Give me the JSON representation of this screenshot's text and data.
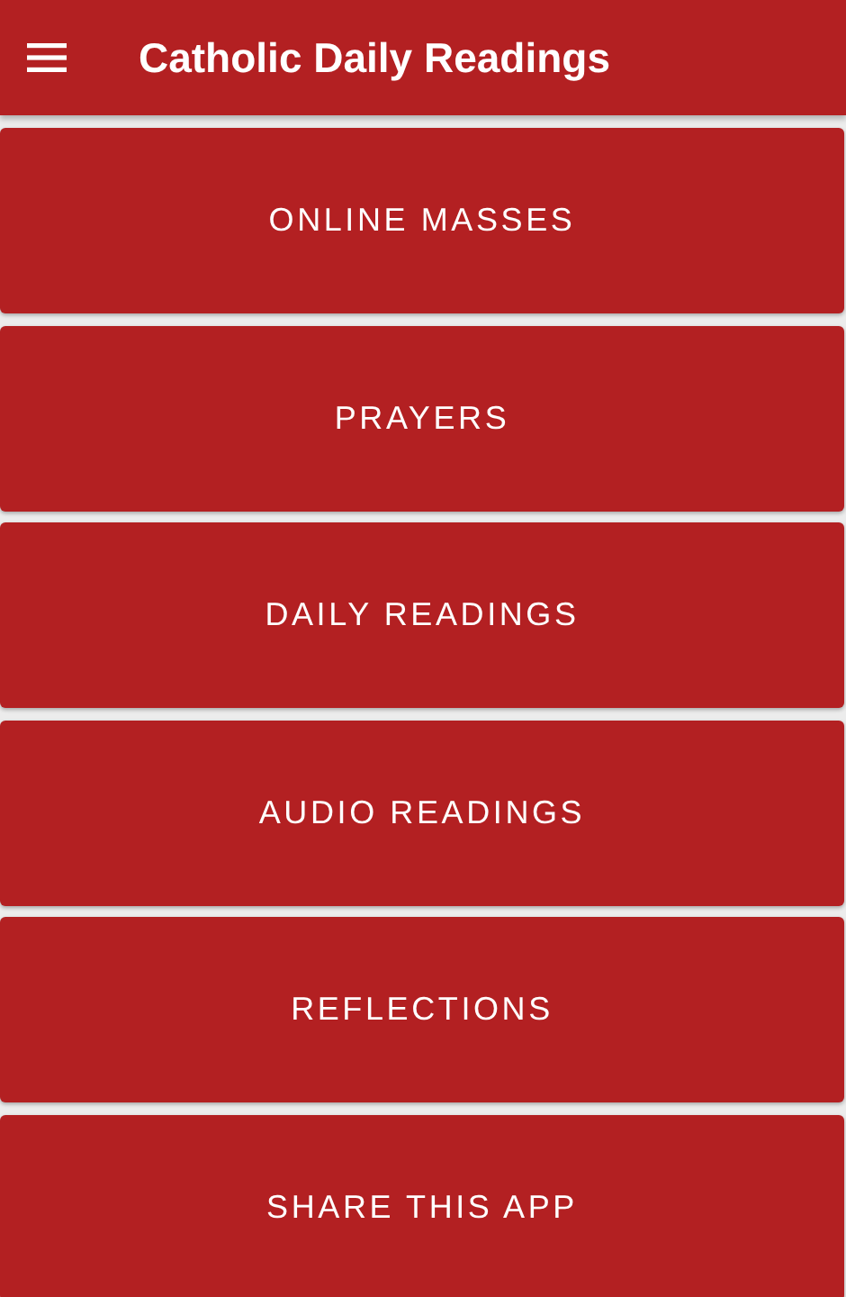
{
  "app_bar": {
    "title": "Catholic Daily Readings"
  },
  "buttons": [
    {
      "label": "ONLINE MASSES"
    },
    {
      "label": "PRAYERS"
    },
    {
      "label": "DAILY READINGS"
    },
    {
      "label": "AUDIO READINGS"
    },
    {
      "label": "REFLECTIONS"
    },
    {
      "label": "SHARE THIS APP"
    }
  ]
}
